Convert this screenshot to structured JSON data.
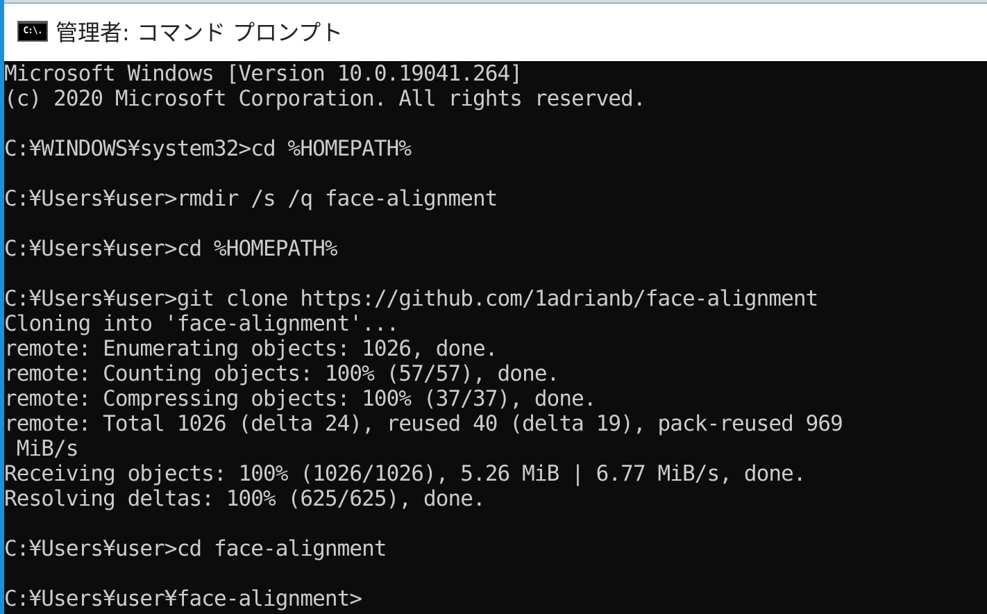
{
  "window": {
    "icon_text": "C:\\.",
    "icon_name": "cmd-icon",
    "title": "管理者: コマンド プロンプト"
  },
  "colors": {
    "console_bg": "#0c0c0c",
    "console_fg": "#cccccc",
    "title_bar_bg": "#ffffff",
    "window_border_accent": "#1e90d8"
  },
  "console": {
    "lines": [
      "Microsoft Windows [Version 10.0.19041.264]",
      "(c) 2020 Microsoft Corporation. All rights reserved.",
      "",
      "C:¥WINDOWS¥system32>cd %HOMEPATH%",
      "",
      "C:¥Users¥user>rmdir /s /q face-alignment",
      "",
      "C:¥Users¥user>cd %HOMEPATH%",
      "",
      "C:¥Users¥user>git clone https://github.com/1adrianb/face-alignment",
      "Cloning into 'face-alignment'...",
      "remote: Enumerating objects: 1026, done.",
      "remote: Counting objects: 100% (57/57), done.",
      "remote: Compressing objects: 100% (37/37), done.",
      "remote: Total 1026 (delta 24), reused 40 (delta 19), pack-reused 969",
      " MiB/s",
      "Receiving objects: 100% (1026/1026), 5.26 MiB | 6.77 MiB/s, done.",
      "Resolving deltas: 100% (625/625), done.",
      "",
      "C:¥Users¥user>cd face-alignment",
      "",
      "C:¥Users¥user¥face-alignment>"
    ]
  }
}
